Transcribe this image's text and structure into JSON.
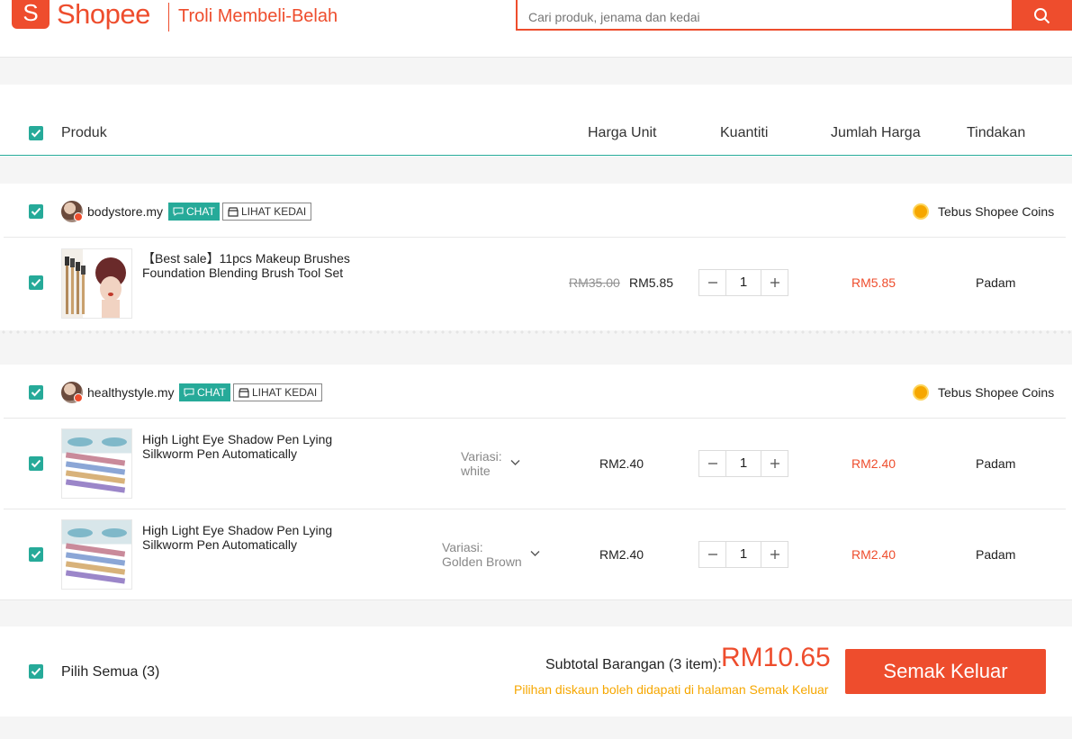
{
  "header": {
    "logo_text": "Shopee",
    "page_title": "Troli Membeli-Belah",
    "search_placeholder": "Cari produk, jenama dan kedai"
  },
  "columns": {
    "product": "Produk",
    "unit_price": "Harga Unit",
    "quantity": "Kuantiti",
    "total_price": "Jumlah Harga",
    "action": "Tindakan"
  },
  "shops": [
    {
      "name": "bodystore.my",
      "chat_label": "CHAT",
      "view_shop_label": "LIHAT KEDAI",
      "coins_label": "Tebus Shopee Coins",
      "items": [
        {
          "name": "【Best sale】11pcs Makeup Brushes Foundation Blending Brush Tool Set",
          "original_price": "RM35.00",
          "price": "RM5.85",
          "quantity": "1",
          "total": "RM5.85",
          "action": "Padam"
        }
      ]
    },
    {
      "name": "healthystyle.my",
      "chat_label": "CHAT",
      "view_shop_label": "LIHAT KEDAI",
      "coins_label": "Tebus Shopee Coins",
      "items": [
        {
          "name": "High Light Eye Shadow Pen Lying Silkworm Pen Automatically",
          "variation_label": "Variasi:",
          "variation_value": "white",
          "price": "RM2.40",
          "quantity": "1",
          "total": "RM2.40",
          "action": "Padam"
        },
        {
          "name": "High Light Eye Shadow Pen Lying Silkworm Pen Automatically",
          "variation_label": "Variasi:",
          "variation_value": "Golden Brown",
          "price": "RM2.40",
          "quantity": "1",
          "total": "RM2.40",
          "action": "Padam"
        }
      ]
    }
  ],
  "footer": {
    "select_all": "Pilih Semua (3)",
    "subtotal_label": "Subtotal Barangan (3 item):",
    "subtotal_value": "RM10.65",
    "discount_note": "Pilihan diskaun boleh didapati di halaman Semak Keluar",
    "checkout_label": "Semak Keluar"
  },
  "colors": {
    "brand": "#ee4d2d",
    "checkbox": "#26aa99",
    "coin": "#f6a700"
  },
  "icons": [
    "search-icon",
    "check-icon",
    "chat-icon",
    "shop-icon",
    "coin-icon",
    "chevron-down-icon",
    "minus-icon",
    "plus-icon"
  ]
}
